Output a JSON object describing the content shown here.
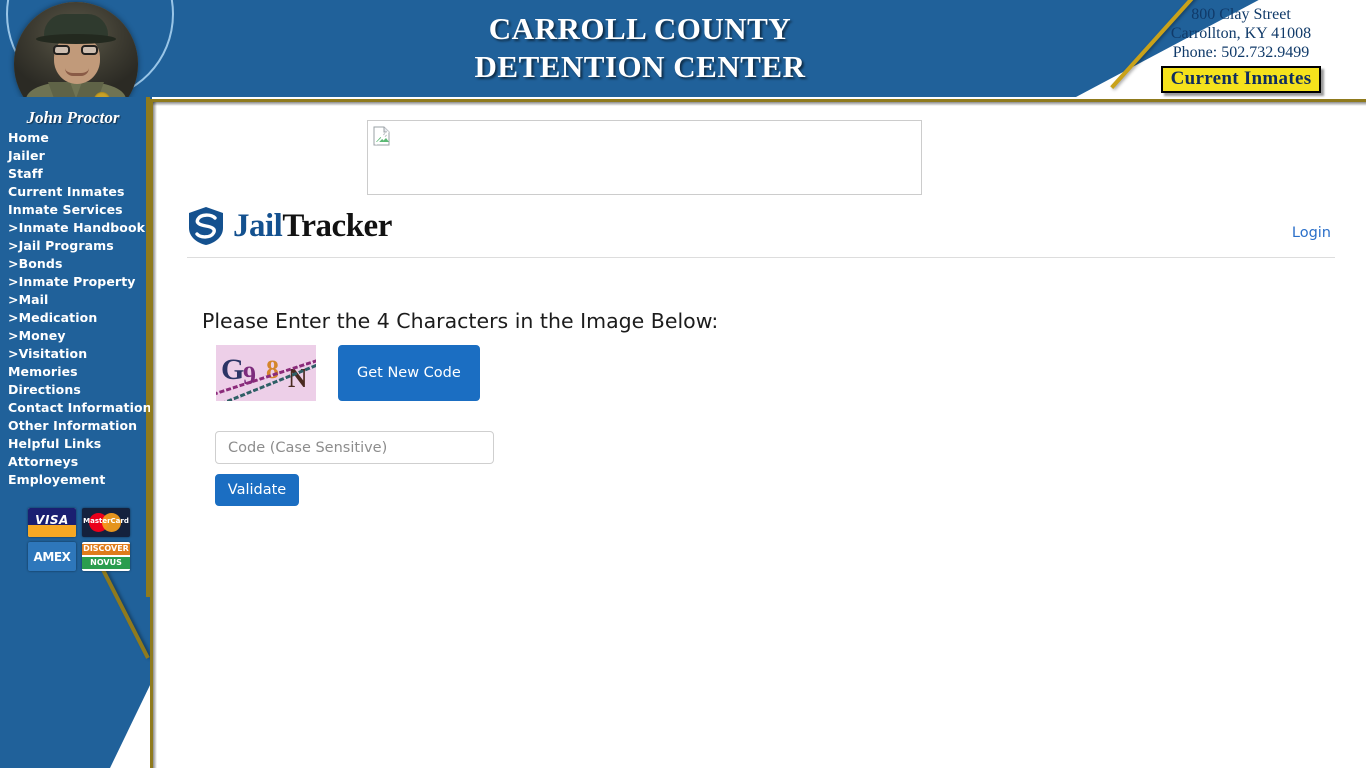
{
  "header": {
    "facility_title_line1": "CARROLL COUNTY",
    "facility_title_line2": "DETENTION CENTER",
    "address_line1": "800 Clay Street",
    "address_line2": "Carrollton, KY 41008",
    "address_line3": "Phone: 502.732.9499",
    "current_inmates_button": "Current Inmates",
    "photo_alt": "jailer-portrait"
  },
  "sidebar": {
    "jailer_name": "John Proctor",
    "items": [
      {
        "label": "Home",
        "sub": false
      },
      {
        "label": "Jailer",
        "sub": false
      },
      {
        "label": "Staff",
        "sub": false
      },
      {
        "label": "Current Inmates",
        "sub": false
      },
      {
        "label": "Inmate Services",
        "sub": false
      },
      {
        "label": "Inmate Handbook",
        "sub": true
      },
      {
        "label": "Jail Programs",
        "sub": true
      },
      {
        "label": "Bonds",
        "sub": true
      },
      {
        "label": "Inmate Property",
        "sub": true
      },
      {
        "label": "Mail",
        "sub": true
      },
      {
        "label": "Medication",
        "sub": true
      },
      {
        "label": "Money",
        "sub": true
      },
      {
        "label": "Visitation",
        "sub": true
      },
      {
        "label": "Memories",
        "sub": false
      },
      {
        "label": "Directions",
        "sub": false
      },
      {
        "label": "Contact Information",
        "sub": false
      },
      {
        "label": "Other Information",
        "sub": false
      },
      {
        "label": "Helpful Links",
        "sub": false
      },
      {
        "label": "Attorneys",
        "sub": false
      },
      {
        "label": "Employement",
        "sub": false
      }
    ],
    "sub_prefix": ">",
    "payment_cards": [
      {
        "name": "visa-card-logo",
        "label": "VISA"
      },
      {
        "name": "mastercard-card-logo",
        "label": "MasterCard"
      },
      {
        "name": "amex-card-logo",
        "label": "AMEX"
      },
      {
        "name": "discover-novus-card-logo",
        "label": "DISCOVER",
        "sub_label": "NOVUS"
      }
    ]
  },
  "main": {
    "banner_image_alt": "broken-image-placeholder",
    "brand_jail": "Jail",
    "brand_tracker": "Tracker",
    "login_link": "Login",
    "prompt": "Please Enter the 4 Characters in the Image Below:",
    "captcha_characters": [
      "G",
      "9",
      "8",
      "N"
    ],
    "get_new_code_button": "Get New Code",
    "code_input_value": "",
    "code_input_placeholder": "Code (Case Sensitive)",
    "validate_button": "Validate"
  },
  "colors": {
    "header_blue": "#20619a",
    "gold_border": "#8f7a1d",
    "button_blue": "#1b6ec2",
    "link_blue": "#2a6fc9",
    "yellow_button": "#f5e21c",
    "brand_blue": "#14518f",
    "captcha_bg": "#edcfe8"
  }
}
